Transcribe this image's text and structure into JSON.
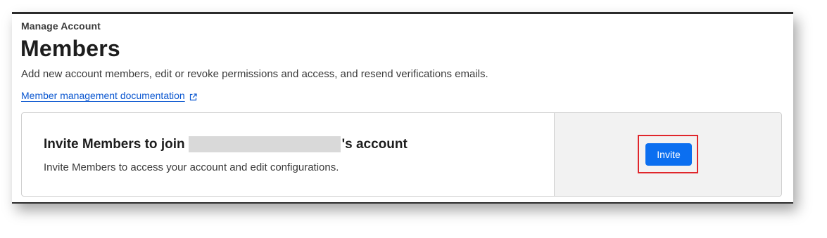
{
  "breadcrumb": "Manage Account",
  "page_title": "Members",
  "description": "Add new account members, edit or revoke permissions and access, and resend verifications emails.",
  "doc_link": {
    "label": "Member management documentation",
    "icon": "external-link-icon"
  },
  "invite_card": {
    "title_prefix": "Invite Members to join",
    "title_suffix": "'s account",
    "subtitle": "Invite Members to access your account and edit configurations.",
    "button_label": "Invite"
  },
  "colors": {
    "accent": "#0b6ff0",
    "link": "#0b57d0",
    "highlight": "#e0262b",
    "panel": "#f2f2f2"
  }
}
